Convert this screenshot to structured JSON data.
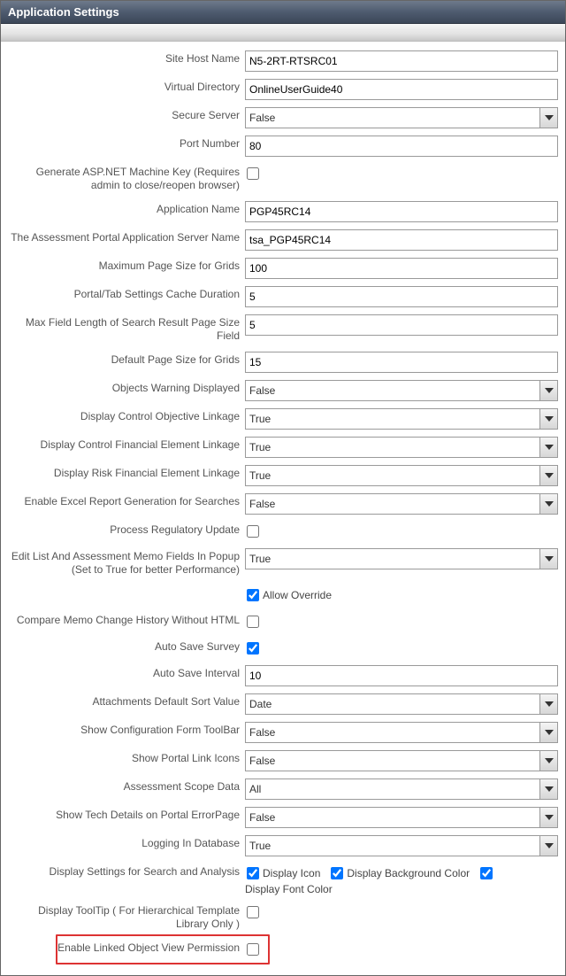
{
  "header": {
    "title": "Application Settings"
  },
  "fields": {
    "site_host_name": {
      "label": "Site Host Name",
      "value": "N5-2RT-RTSRC01"
    },
    "virtual_directory": {
      "label": "Virtual Directory",
      "value": "OnlineUserGuide40"
    },
    "secure_server": {
      "label": "Secure Server",
      "value": "False"
    },
    "port_number": {
      "label": "Port Number",
      "value": "80"
    },
    "gen_machine_key": {
      "label": "Generate ASP.NET Machine Key (Requires admin to close/reopen browser)",
      "checked": false
    },
    "application_name": {
      "label": "Application Name",
      "value": "PGP45RC14"
    },
    "portal_app_server": {
      "label": "The Assessment Portal Application Server Name",
      "value": "tsa_PGP45RC14"
    },
    "max_page_size_grids": {
      "label": "Maximum Page Size for Grids",
      "value": "100"
    },
    "cache_duration": {
      "label": "Portal/Tab Settings Cache Duration",
      "value": "5"
    },
    "max_field_len": {
      "label": "Max Field Length of Search Result Page Size Field",
      "value": "5"
    },
    "default_page_size": {
      "label": "Default Page Size for Grids",
      "value": "15"
    },
    "objects_warning": {
      "label": "Objects Warning Displayed",
      "value": "False"
    },
    "disp_ctrl_obj_link": {
      "label": "Display Control Objective Linkage",
      "value": "True"
    },
    "disp_ctrl_fin_link": {
      "label": "Display Control Financial Element Linkage",
      "value": "True"
    },
    "disp_risk_fin_link": {
      "label": "Display Risk Financial Element Linkage",
      "value": "True"
    },
    "excel_report": {
      "label": "Enable Excel Report Generation for Searches",
      "value": "False"
    },
    "process_reg_update": {
      "label": "Process Regulatory Update",
      "checked": false
    },
    "edit_memo_popup": {
      "label": "Edit List And Assessment Memo Fields In Popup (Set to True for better Performance)",
      "value": "True"
    },
    "allow_override": {
      "label": "Allow Override",
      "checked": true
    },
    "compare_memo": {
      "label": "Compare Memo Change History Without HTML",
      "checked": false
    },
    "auto_save_survey": {
      "label": "Auto Save Survey",
      "checked": true
    },
    "auto_save_interval": {
      "label": "Auto Save Interval",
      "value": "10"
    },
    "attach_sort": {
      "label": "Attachments Default Sort Value",
      "value": "Date"
    },
    "show_cfg_toolbar": {
      "label": "Show Configuration Form ToolBar",
      "value": "False"
    },
    "show_portal_icons": {
      "label": "Show Portal Link Icons",
      "value": "False"
    },
    "assess_scope_data": {
      "label": "Assessment Scope Data",
      "value": "All"
    },
    "show_tech_error": {
      "label": "Show Tech Details on Portal ErrorPage",
      "value": "False"
    },
    "logging_db": {
      "label": "Logging In Database",
      "value": "True"
    },
    "disp_search_analysis": {
      "label": "Display Settings for Search and Analysis",
      "icon": {
        "label": "Display Icon",
        "checked": true
      },
      "bg_color": {
        "label": "Display Background Color",
        "checked": true
      },
      "font": {
        "label": "Display Font Color",
        "checked": true
      }
    },
    "tooltip_hier": {
      "label": "Display ToolTip ( For Hierarchical Template Library Only )",
      "checked": false
    },
    "enable_linked_obj": {
      "label": "Enable Linked Object View Permission",
      "checked": false
    }
  }
}
